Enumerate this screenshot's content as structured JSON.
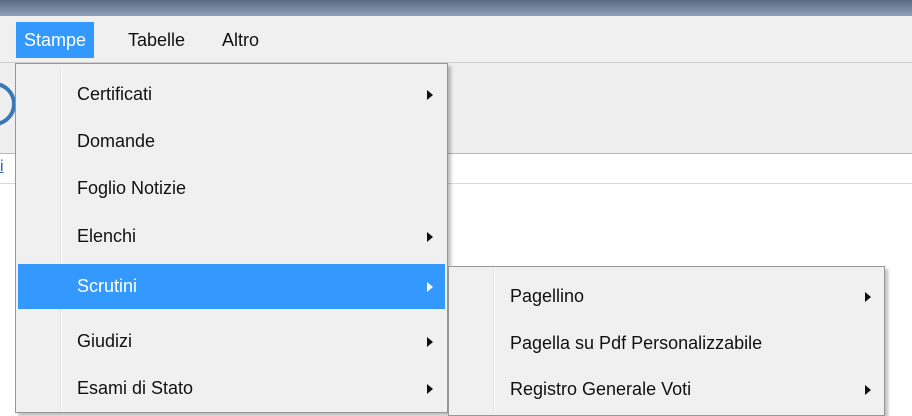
{
  "menubar": {
    "items": [
      {
        "label": "Stampe"
      },
      {
        "label": "Tabelle"
      },
      {
        "label": "Altro"
      }
    ]
  },
  "stampe_menu": {
    "items": [
      {
        "label": "Certificati",
        "has_submenu": true
      },
      {
        "label": "Domande",
        "has_submenu": false
      },
      {
        "label": "Foglio Notizie",
        "has_submenu": false
      },
      {
        "label": "Elenchi",
        "has_submenu": true
      },
      {
        "label": "Scrutini",
        "has_submenu": true,
        "highlighted": true
      },
      {
        "label": "Giudizi",
        "has_submenu": true
      },
      {
        "label": "Esami di Stato",
        "has_submenu": true
      }
    ]
  },
  "scrutini_submenu": {
    "items": [
      {
        "label": "Pagellino",
        "has_submenu": true
      },
      {
        "label": "Pagella su Pdf Personalizzabile",
        "has_submenu": false
      },
      {
        "label": "Registro Generale Voti",
        "has_submenu": true
      }
    ]
  },
  "background": {
    "link_fragment": "i"
  },
  "colors": {
    "highlight": "#3399ff",
    "menu_background": "#f0f0f0"
  }
}
